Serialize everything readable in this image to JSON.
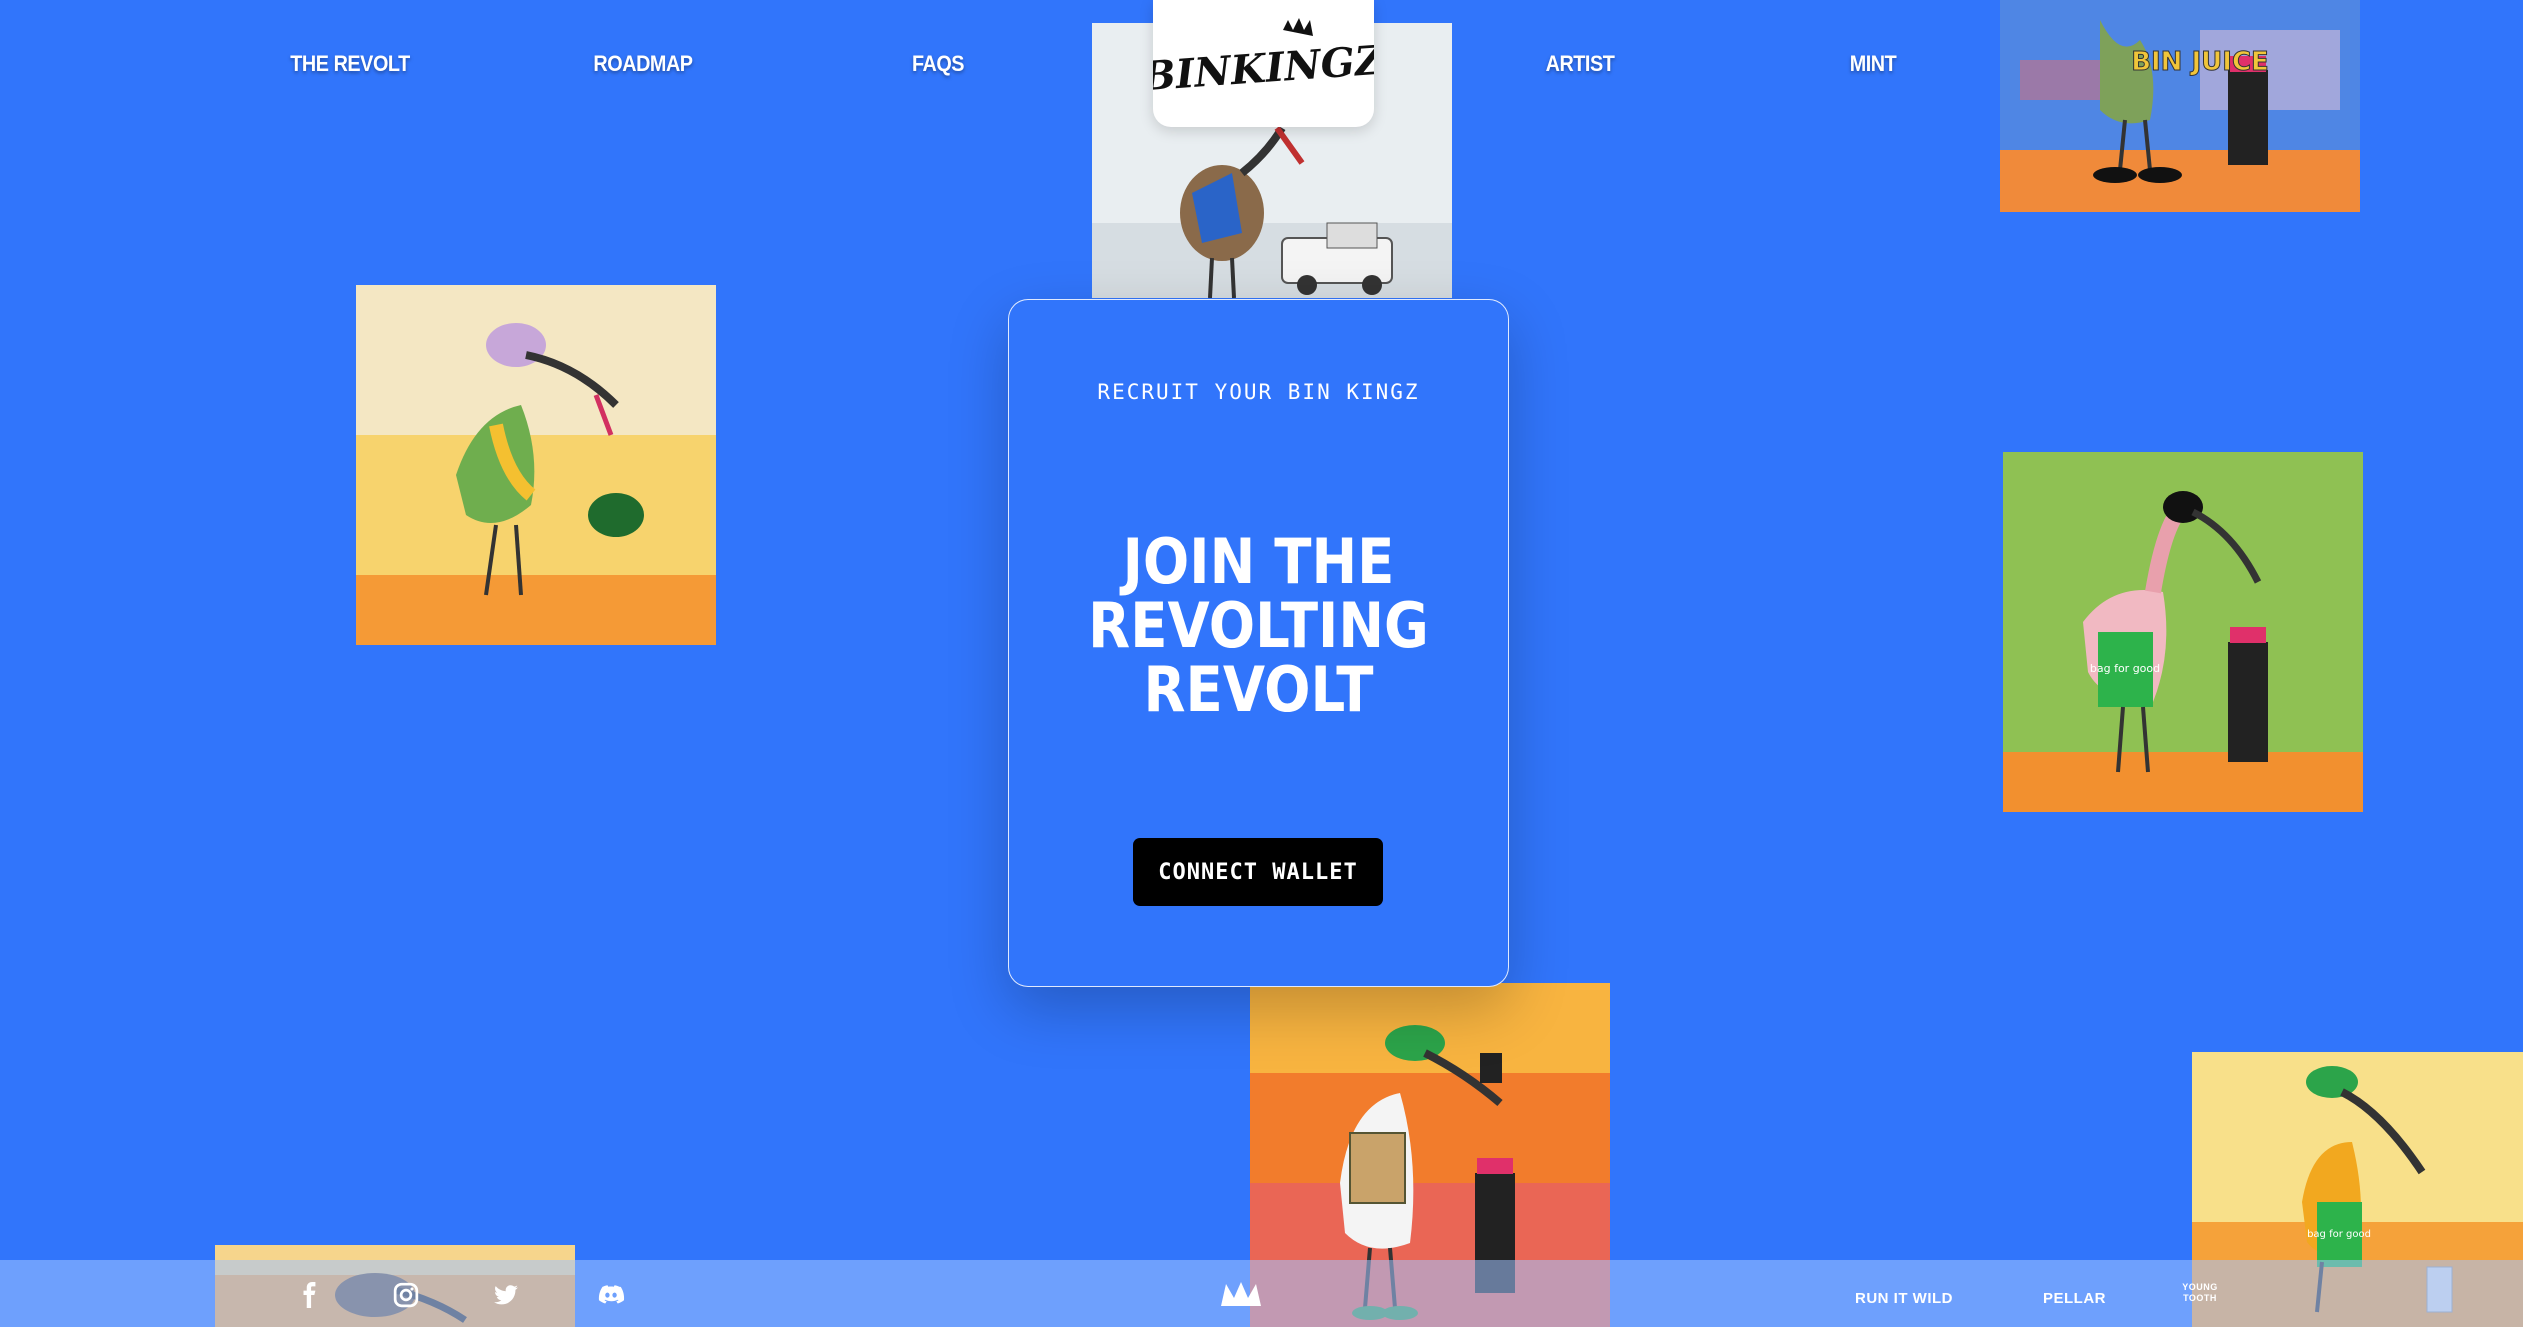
{
  "nav": {
    "left": [
      "THE REVOLT",
      "ROADMAP",
      "FAQS"
    ],
    "right": [
      "ARTIST",
      "MINT"
    ]
  },
  "logo": {
    "text": "BINKINGZ",
    "icon": "crown-icon"
  },
  "card": {
    "eyebrow": "RECRUIT YOUR BIN KINGZ",
    "title": "JOIN THE\nREVOLTING\nREVOLT",
    "button": "CONNECT WALLET"
  },
  "artworks": [
    {
      "name": "ibis-with-truck",
      "bg": "#e8eef2"
    },
    {
      "name": "ibis-bin-juice",
      "text": "BIN JUICE",
      "bg": "#4a7fe0"
    },
    {
      "name": "ibis-pink-cap",
      "bg": "#f6c04a"
    },
    {
      "name": "flamingo-green",
      "text": "bag for good",
      "bg": "#8fc153"
    },
    {
      "name": "ibis-green-cap-orange",
      "bg": "#f07a2d"
    },
    {
      "name": "ibis-yellow-bag",
      "text": "bag for good",
      "bg": "#f8d96a"
    },
    {
      "name": "ibis-footer-partial",
      "bg": "#f5a94a"
    }
  ],
  "footer": {
    "social": [
      "facebook-icon",
      "instagram-icon",
      "twitter-icon",
      "discord-icon"
    ],
    "center_icon": "crown-icon",
    "partners": [
      "RUN IT WILD",
      "PELLAR",
      "YOUNG TOOTH"
    ]
  },
  "colors": {
    "background": "#3175fb",
    "button": "#000000",
    "footer": "#8fb6ff"
  }
}
